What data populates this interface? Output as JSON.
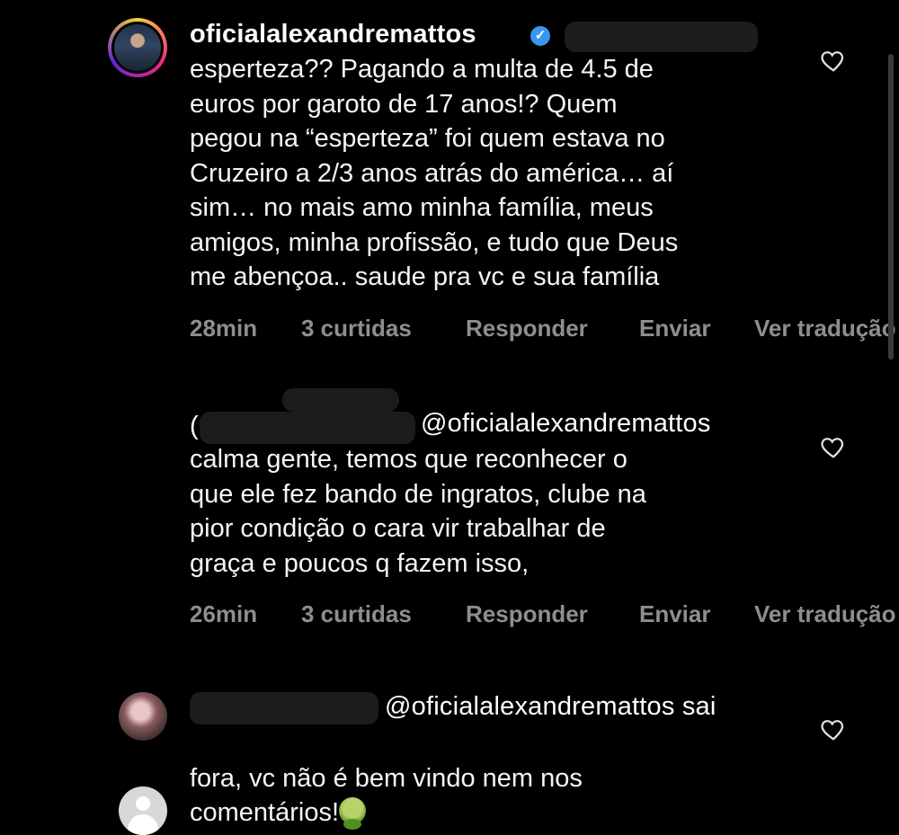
{
  "comments": [
    {
      "username": "oficialalexandremattos",
      "verified": true,
      "text": "esperteza?? Pagando a multa de 4.5 de\neuros por garoto de 17 anos!? Quem\npegou na “esperteza” foi quem estava no\nCruzeiro a 2/3 anos atrás do américa… aí\nsim… no mais amo minha família, meus\namigos, minha profissão, e tudo que Deus\nme abençoa.. saude pra vc e sua família",
      "time": "28min",
      "likes": "3 curtidas",
      "reply": "Responder",
      "send": "Enviar",
      "translate": "Ver tradução"
    },
    {
      "username_prefix": "(",
      "mention": "@oficialalexandremattos",
      "text": "calma gente, temos que reconhecer o\nque ele fez bando de ingratos, clube na\npior condição o cara vir trabalhar de\ngraça e poucos q fazem isso,",
      "time": "26min",
      "likes": "3 curtidas",
      "reply": "Responder",
      "send": "Enviar",
      "translate": "Ver tradução"
    },
    {
      "mention_line": "@oficialalexandremattos sai",
      "text": "fora, vc não é bem vindo nem nos\ncomentários!"
    }
  ],
  "icons": {
    "heart": "heart-outline-icon",
    "verified": "verified-badge-icon",
    "emoji": "nauseated-face-emoji"
  },
  "colors": {
    "background": "#000000",
    "text": "#f5f5f5",
    "meta": "#8e8e8e",
    "verified": "#3897f0"
  }
}
